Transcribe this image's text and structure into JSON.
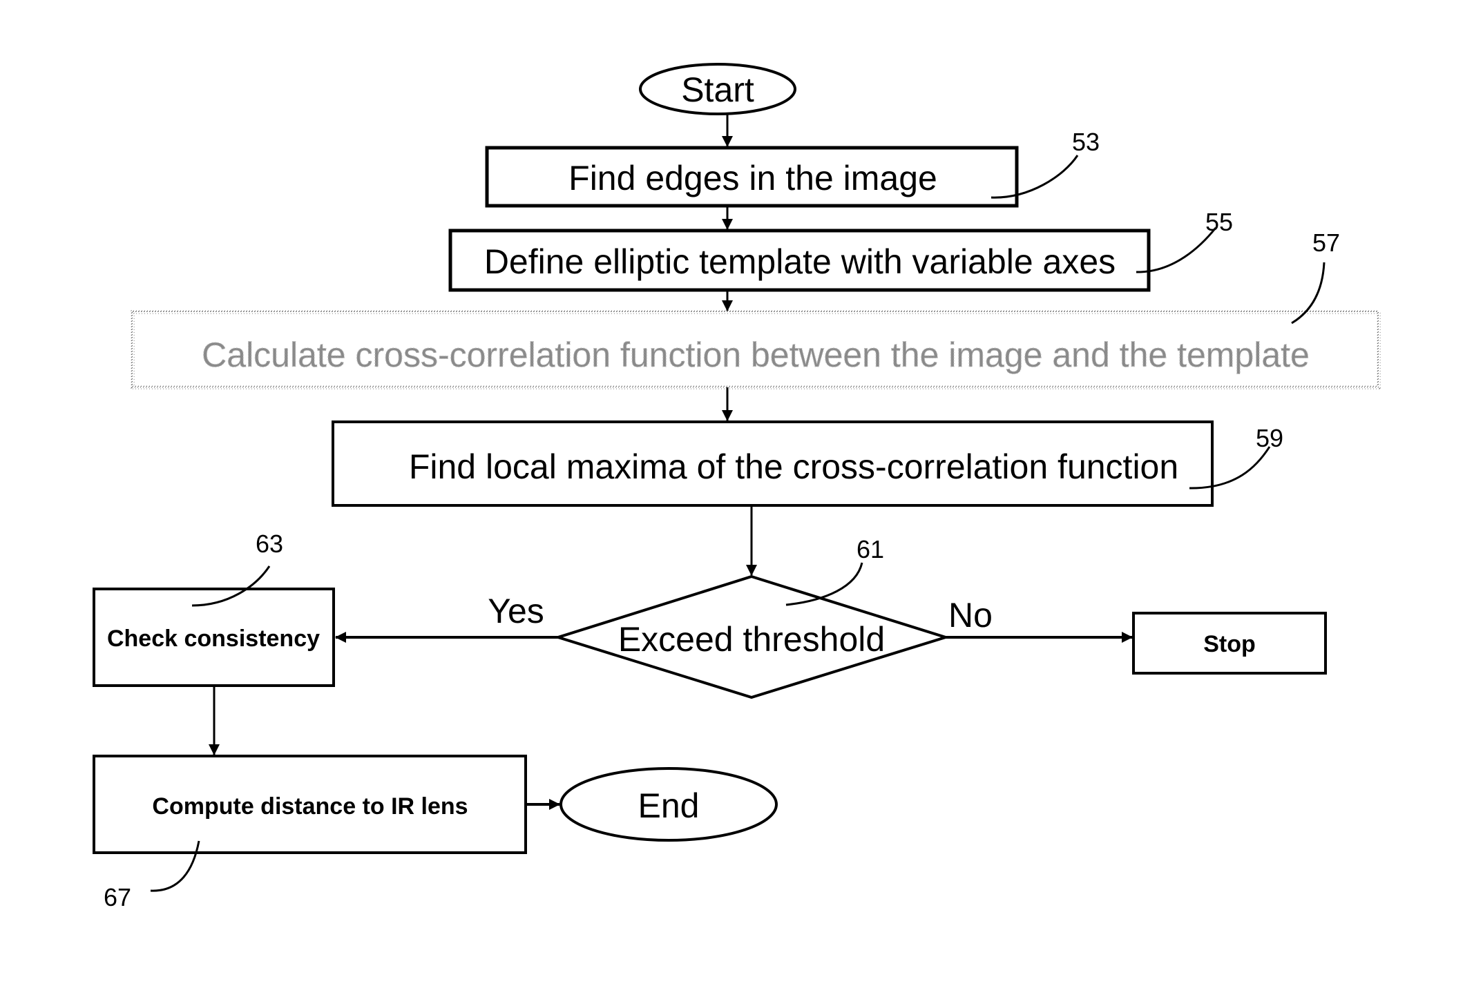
{
  "diagram": {
    "type": "flowchart",
    "nodes": {
      "start": {
        "label": "Start",
        "shape": "ellipse"
      },
      "find_edges": {
        "label": "Find edges in the image",
        "ref": "53",
        "shape": "rect"
      },
      "define_template": {
        "label": "Define elliptic template with variable axes",
        "ref": "55",
        "shape": "rect"
      },
      "cross_corr": {
        "label": "Calculate cross-correlation function between the image and the template",
        "ref": "57",
        "shape": "rect-dotted"
      },
      "local_max": {
        "label": "Find local maxima of the cross-correlation function",
        "ref": "59",
        "shape": "rect"
      },
      "threshold": {
        "label": "Exceed threshold",
        "ref": "61",
        "shape": "diamond"
      },
      "check": {
        "label": "Check consistency",
        "ref": "63",
        "shape": "rect"
      },
      "stop": {
        "label": "Stop",
        "shape": "rect"
      },
      "compute": {
        "label": "Compute distance to IR lens",
        "ref": "67",
        "shape": "rect"
      },
      "end": {
        "label": "End",
        "shape": "ellipse"
      }
    },
    "edges": [
      {
        "from": "start",
        "to": "find_edges"
      },
      {
        "from": "find_edges",
        "to": "define_template"
      },
      {
        "from": "define_template",
        "to": "cross_corr"
      },
      {
        "from": "cross_corr",
        "to": "local_max"
      },
      {
        "from": "local_max",
        "to": "threshold"
      },
      {
        "from": "threshold",
        "to": "check",
        "label": "Yes"
      },
      {
        "from": "threshold",
        "to": "stop",
        "label": "No"
      },
      {
        "from": "check",
        "to": "compute"
      },
      {
        "from": "compute",
        "to": "end"
      }
    ],
    "branch_labels": {
      "yes": "Yes",
      "no": "No"
    }
  }
}
